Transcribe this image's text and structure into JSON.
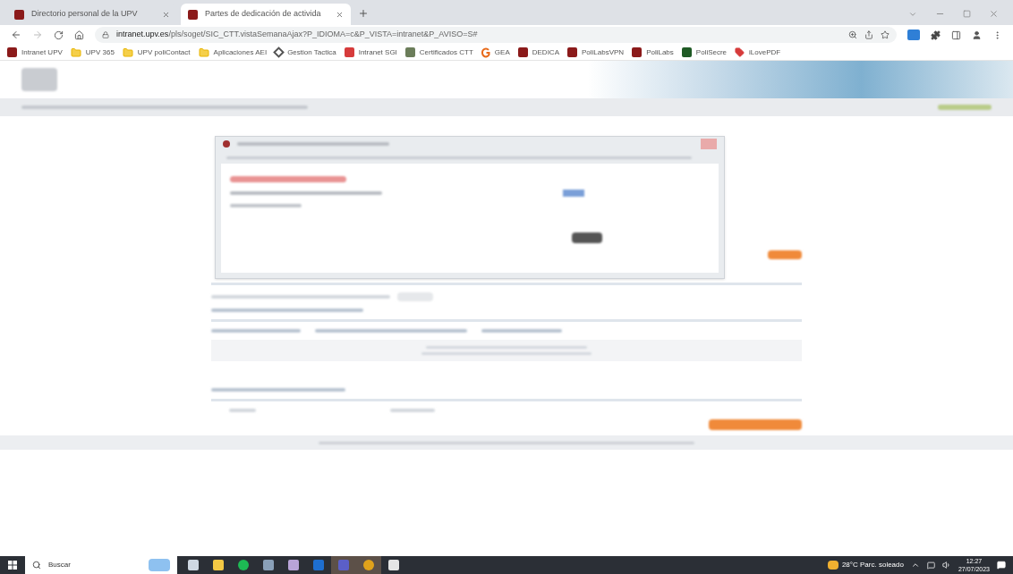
{
  "tabs": [
    {
      "title": "Directorio personal de la UPV",
      "selected": false
    },
    {
      "title": "Partes de dedicación de activida",
      "selected": true
    }
  ],
  "address": {
    "url_host": "intranet.upv.es",
    "url_path": "/pls/soget/SIC_CTT.vistaSemanaAjax?P_IDIOMA=c&P_VISTA=intranet&P_AVISO=S#"
  },
  "bookmarks": [
    {
      "label": "Intranet UPV",
      "kind": "upv"
    },
    {
      "label": "UPV 365",
      "kind": "folder"
    },
    {
      "label": "UPV poliContact",
      "kind": "folder"
    },
    {
      "label": "Aplicaciones AEI",
      "kind": "folder"
    },
    {
      "label": "Gestion Tactica",
      "kind": "diamond"
    },
    {
      "label": "Intranet SGI",
      "kind": "sgi"
    },
    {
      "label": "Certificados CTT",
      "kind": "cert"
    },
    {
      "label": "GEA",
      "kind": "g"
    },
    {
      "label": "DEDICA",
      "kind": "upv"
    },
    {
      "label": "PoliLabsVPN",
      "kind": "upv"
    },
    {
      "label": "PoliLabs",
      "kind": "upv"
    },
    {
      "label": "PoliSecre",
      "kind": "green"
    },
    {
      "label": "iLovePDF",
      "kind": "tag"
    }
  ],
  "taskbar": {
    "search_placeholder": "Buscar",
    "apps": [
      {
        "kind": "taskview",
        "selected": false
      },
      {
        "kind": "files",
        "selected": false
      },
      {
        "kind": "music",
        "selected": false
      },
      {
        "kind": "calc",
        "selected": false
      },
      {
        "kind": "paint",
        "selected": false
      },
      {
        "kind": "mail",
        "selected": false
      },
      {
        "kind": "teams",
        "selected": true
      },
      {
        "kind": "chrome",
        "selected": true
      },
      {
        "kind": "pdf",
        "selected": false
      }
    ],
    "weather_temp": "28°C",
    "weather_text": "Parc. soleado",
    "time": "12:27",
    "date": "27/07/2023"
  }
}
